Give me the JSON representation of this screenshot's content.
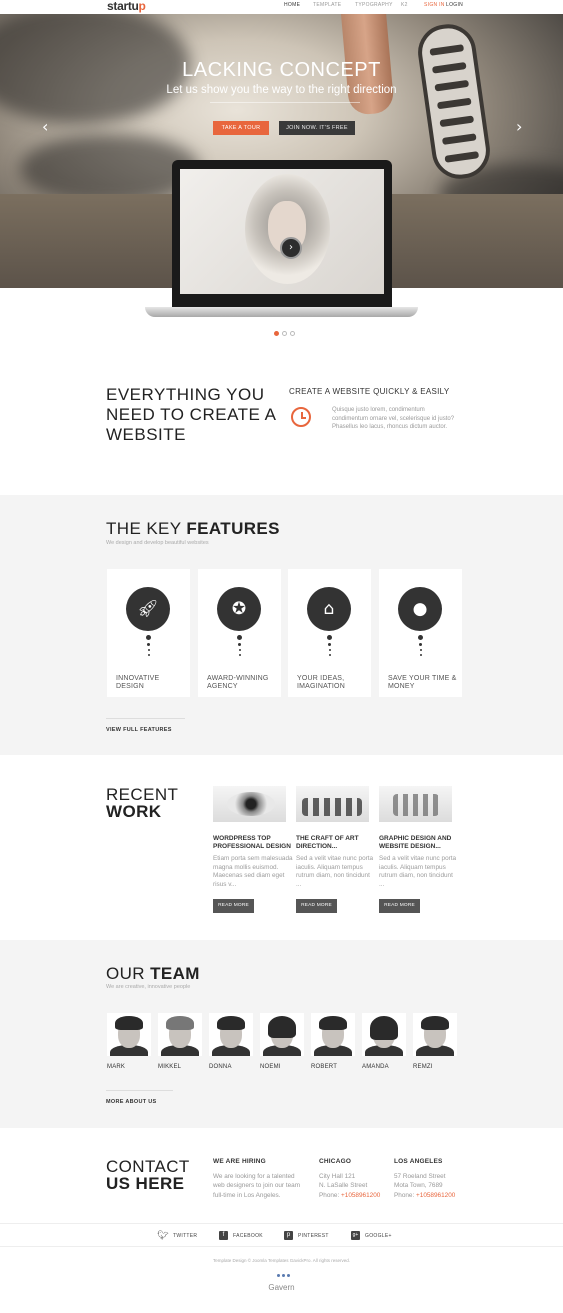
{
  "brand": {
    "logo_main": "startu",
    "logo_accent": "p"
  },
  "nav": {
    "items": [
      "HOME",
      "TEMPLATE",
      "TYPOGRAPHY",
      "K2"
    ],
    "signin": "SIGN IN",
    "login": "LOGIN"
  },
  "hero": {
    "title": "LACKING CONCEPT",
    "subtitle": "Let us show you the way to the right direction",
    "btn_tour": "TAKE A TOUR",
    "btn_join": "JOIN NOW. IT'S FREE"
  },
  "slider": {
    "prev": "‹",
    "next": "›",
    "active_slide": 1,
    "slide_count": 3
  },
  "intro": {
    "heading": "EVERYTHING YOU NEED TO CREATE A WEBSITE",
    "feature_title": "CREATE A WEBSITE QUICKLY & EASILY",
    "feature_text": "Quisque justo lorem, condimentum condimentum ornare vel, scelerisque id justo? Phasellus leo lacus, rhoncus dictum auctor."
  },
  "features": {
    "title_light": "THE KEY ",
    "title_bold": "FEATURES",
    "subtitle": "We design and develop beautiful websites",
    "cards": [
      {
        "icon": "rocket-icon",
        "label": "INNOVATIVE DESIGN"
      },
      {
        "icon": "award-icon",
        "label": "AWARD-WINNING AGENCY"
      },
      {
        "icon": "mouse-icon",
        "label": "YOUR IDEAS, IMAGINATION"
      },
      {
        "icon": "piggy-bank-icon",
        "label": "SAVE YOUR TIME & MONEY"
      }
    ],
    "link": "VIEW FULL FEATURES"
  },
  "work": {
    "title_light": "RECENT",
    "title_bold": "WORK",
    "read_more": "READ MORE",
    "items": [
      {
        "title": "WORDPRESS TOP PROFESSIONAL DESIGN",
        "text": "Etiam porta sem malesuada magna mollis euismod. Maecenas sed diam eget risus v..."
      },
      {
        "title": "THE CRAFT OF ART DIRECTION...",
        "text": "Sed a velit vitae nunc porta iaculis. Aliquam tempus rutrum diam, non tincidunt ..."
      },
      {
        "title": "GRAPHIC DESIGN AND WEBSITE DESIGN...",
        "text": "Sed a velit vitae nunc porta iaculis. Aliquam tempus rutrum diam, non tincidunt ..."
      }
    ]
  },
  "team": {
    "title_light": "OUR ",
    "title_bold": "TEAM",
    "subtitle": "We are creative, innovative people",
    "members": [
      "MARK",
      "MIKKEL",
      "DONNA",
      "NOEMI",
      "ROBERT",
      "AMANDA",
      "REMZI"
    ],
    "link": "MORE ABOUT US"
  },
  "contact": {
    "title_light": "CONTACT",
    "title_bold": "US HERE",
    "hiring": {
      "title": "WE ARE HIRING",
      "lines": [
        "We are looking for a talented",
        "web designers to join our team",
        "full-time in Los Angeles."
      ]
    },
    "chicago": {
      "title": "CHICAGO",
      "lines": [
        "City Hall 121",
        "N. LaSalle Street"
      ],
      "phone_label": "Phone: ",
      "phone": "+1058961200"
    },
    "la": {
      "title": "LOS ANGELES",
      "lines": [
        "57 Roeland Street",
        "Mota Town, 7689"
      ],
      "phone_label": "Phone: ",
      "phone": "+1058961200"
    }
  },
  "social": [
    {
      "icon": "twitter-icon",
      "glyph": "t",
      "label": "TWITTER"
    },
    {
      "icon": "facebook-icon",
      "glyph": "f",
      "label": "FACEBOOK"
    },
    {
      "icon": "pinterest-icon",
      "glyph": "p",
      "label": "PINTEREST"
    },
    {
      "icon": "google-plus-icon",
      "glyph": "g+",
      "label": "GOOGLE+"
    }
  ],
  "footer": {
    "copyright": "Template Design © Joomla Templates GavickPro. All rights reserved.",
    "logo": "Gavern"
  },
  "colors": {
    "accent": "#e8663d",
    "dark": "#333333",
    "light_bg": "#f4f4f4"
  }
}
